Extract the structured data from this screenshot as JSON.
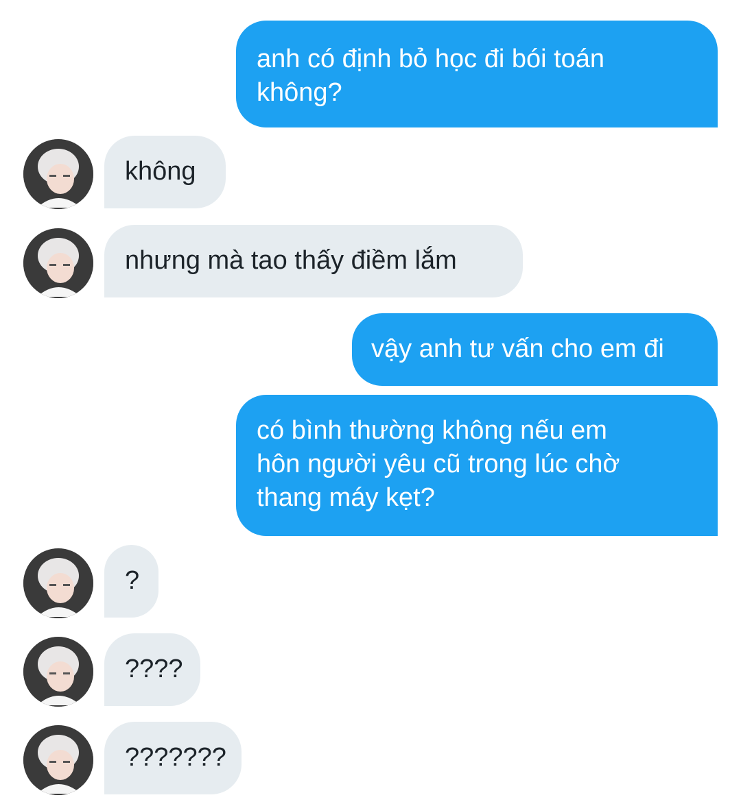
{
  "conversation": {
    "messages": [
      {
        "id": "m1",
        "direction": "sent",
        "text": "anh có định bỏ học đi bói toán\nkhông?"
      },
      {
        "id": "m2",
        "direction": "received",
        "text": "không"
      },
      {
        "id": "m3",
        "direction": "received",
        "text": "nhưng mà tao thấy điềm lắm"
      },
      {
        "id": "m4",
        "direction": "sent",
        "text": "vậy anh tư vấn cho em đi"
      },
      {
        "id": "m5",
        "direction": "sent",
        "text": "có bình thường không nếu em\nhôn người yêu cũ trong lúc chờ\nthang máy kẹt?"
      },
      {
        "id": "m6",
        "direction": "received",
        "text": "?"
      },
      {
        "id": "m7",
        "direction": "received",
        "text": "????"
      },
      {
        "id": "m8",
        "direction": "received",
        "text": "???????"
      }
    ]
  },
  "colors": {
    "sent_bubble": "#1da1f2",
    "sent_text": "#ffffff",
    "received_bubble": "#e6ecf0",
    "received_text": "#1c2329",
    "background": "#ffffff"
  },
  "icons": {
    "avatar": "profile-photo-avatar"
  }
}
